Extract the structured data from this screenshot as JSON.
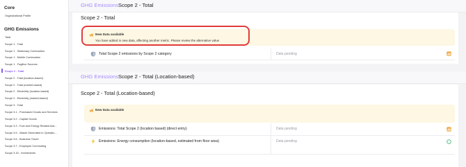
{
  "sidebar": {
    "core_heading": "Core",
    "core_items": [
      {
        "label": "Organizational Profile"
      }
    ],
    "ghg_heading": "GHG Emissions",
    "ghg_items": [
      {
        "label": "Total"
      },
      {
        "label": "Scope 1 - Total"
      },
      {
        "label": "Scope 1 - Stationary Combustion"
      },
      {
        "label": "Scope 1 - Mobile Combustion"
      },
      {
        "label": "Scope 1 - Fugitive Sources"
      },
      {
        "label": "Scope 2 - Total"
      },
      {
        "label": "Scope 2 - Total (location-based)"
      },
      {
        "label": "Scope 2 - Total (market-based)"
      },
      {
        "label": "Scope 2 - Electricity (location-based)"
      },
      {
        "label": "Scope 2 - Electricity (market-based)"
      },
      {
        "label": "Scope 3 - Total"
      },
      {
        "label": "Scope 3.1 - Purchased Goods and Services"
      },
      {
        "label": "Scope 3.2 - Capital Goods"
      },
      {
        "label": "Scope 3.3 - Fuel and Energy Related Acti..."
      },
      {
        "label": "Scope 3.5 - Waste Generated in Operatio..."
      },
      {
        "label": "Scope 3.6 - Business Travel"
      },
      {
        "label": "Scope 3.7 - Employee Commuting"
      },
      {
        "label": "Scope 3.15 - Investments"
      }
    ],
    "active_item": "Scope 2 - Total"
  },
  "section1": {
    "breadcrumb_parent": "GHG Emissions",
    "breadcrumb_current": "Scope 2 - Total",
    "card_title": "Scope 2 - Total",
    "banner_title": "New Data available",
    "banner_message": "You have added in new data, affecting another metric. Please review the alternative value",
    "rows": [
      {
        "label": "Total Scope 2 emissions by Scope 2 category",
        "value": "Data pending",
        "icon": "shield-icon",
        "status_icon": "chart-bar-icon"
      }
    ]
  },
  "section2": {
    "breadcrumb_parent": "GHG Emissions",
    "breadcrumb_current": "Scope 2 - Total (Location-based)",
    "card_title": "Scope 2 - Total (Location-based)",
    "banner_title": "New Data available",
    "rows": [
      {
        "label": "Emissions: Total Scope 2 (location based) (direct entry)",
        "value": "Data pending",
        "icon": "shield-icon",
        "status_icon": "chart-bar-icon"
      },
      {
        "label": "Emissions: Energy consumption (location-based, estimated from floor area)",
        "value": "Data pending",
        "icon": "lightning-icon",
        "status_icon": "circle-icon"
      }
    ]
  },
  "colors": {
    "accent": "#8b5cf6",
    "banner_bg": "#fdf7e3",
    "highlight": "#e23a3a",
    "status_orange": "#f0a43a",
    "status_green": "#3bb273"
  }
}
